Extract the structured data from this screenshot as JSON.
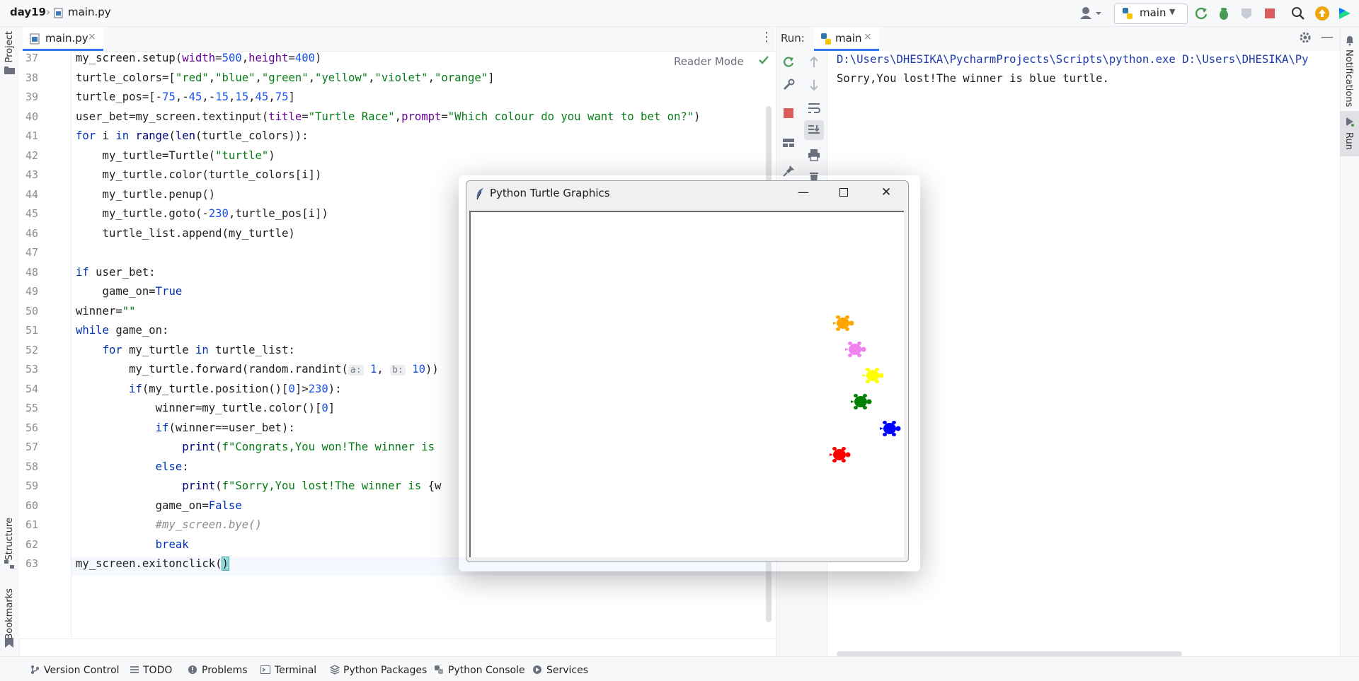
{
  "topbar": {
    "project": "day19",
    "separator": "›",
    "file": "main.py",
    "branch": "main"
  },
  "left_strip": {
    "project_label": "Project",
    "structure_label": "Structure",
    "bookmarks_label": "Bookmarks"
  },
  "right_strip": {
    "notifications_label": "Notifications",
    "run_label": "Run"
  },
  "editor": {
    "tab_label": "main.py",
    "tab_close": "×",
    "more_glyph": "⋮",
    "reader_mode": "Reader Mode",
    "line_numbers": [
      "37",
      "38",
      "39",
      "40",
      "41",
      "42",
      "43",
      "44",
      "45",
      "46",
      "47",
      "48",
      "49",
      "50",
      "51",
      "52",
      "53",
      "54",
      "55",
      "56",
      "57",
      "58",
      "59",
      "60",
      "61",
      "62",
      "63"
    ],
    "lines": [
      {
        "segs": [
          {
            "t": "my_screen.setup(",
            "c": ""
          },
          {
            "t": "width",
            "c": "pm"
          },
          {
            "t": "=",
            "c": ""
          },
          {
            "t": "500",
            "c": "nm"
          },
          {
            "t": ",",
            "c": ""
          },
          {
            "t": "height",
            "c": "pm"
          },
          {
            "t": "=",
            "c": ""
          },
          {
            "t": "400",
            "c": "nm"
          },
          {
            "t": ")",
            "c": ""
          }
        ]
      },
      {
        "segs": [
          {
            "t": "turtle_colors=[",
            "c": ""
          },
          {
            "t": "\"red\"",
            "c": "st"
          },
          {
            "t": ",",
            "c": ""
          },
          {
            "t": "\"blue\"",
            "c": "st"
          },
          {
            "t": ",",
            "c": ""
          },
          {
            "t": "\"green\"",
            "c": "st"
          },
          {
            "t": ",",
            "c": ""
          },
          {
            "t": "\"yellow\"",
            "c": "st"
          },
          {
            "t": ",",
            "c": ""
          },
          {
            "t": "\"violet\"",
            "c": "st"
          },
          {
            "t": ",",
            "c": ""
          },
          {
            "t": "\"orange\"",
            "c": "st"
          },
          {
            "t": "]",
            "c": ""
          }
        ]
      },
      {
        "segs": [
          {
            "t": "turtle_pos=[-",
            "c": ""
          },
          {
            "t": "75",
            "c": "nm"
          },
          {
            "t": ",-",
            "c": ""
          },
          {
            "t": "45",
            "c": "nm"
          },
          {
            "t": ",-",
            "c": ""
          },
          {
            "t": "15",
            "c": "nm"
          },
          {
            "t": ",",
            "c": ""
          },
          {
            "t": "15",
            "c": "nm"
          },
          {
            "t": ",",
            "c": ""
          },
          {
            "t": "45",
            "c": "nm"
          },
          {
            "t": ",",
            "c": ""
          },
          {
            "t": "75",
            "c": "nm"
          },
          {
            "t": "]",
            "c": ""
          }
        ]
      },
      {
        "segs": [
          {
            "t": "user_bet=my_screen.textinput(",
            "c": ""
          },
          {
            "t": "title",
            "c": "pm"
          },
          {
            "t": "=",
            "c": ""
          },
          {
            "t": "\"Turtle Race\"",
            "c": "st"
          },
          {
            "t": ",",
            "c": ""
          },
          {
            "t": "prompt",
            "c": "pm"
          },
          {
            "t": "=",
            "c": ""
          },
          {
            "t": "\"Which colour do you want to bet on?\"",
            "c": "st"
          },
          {
            "t": ")",
            "c": ""
          }
        ]
      },
      {
        "segs": [
          {
            "t": "for",
            "c": "kw"
          },
          {
            "t": " i ",
            "c": ""
          },
          {
            "t": "in",
            "c": "kw"
          },
          {
            "t": " ",
            "c": ""
          },
          {
            "t": "range",
            "c": "bi"
          },
          {
            "t": "(",
            "c": ""
          },
          {
            "t": "len",
            "c": "bi"
          },
          {
            "t": "(turtle_colors)):",
            "c": ""
          }
        ]
      },
      {
        "segs": [
          {
            "t": "    my_turtle=Turtle(",
            "c": ""
          },
          {
            "t": "\"turtle\"",
            "c": "st"
          },
          {
            "t": ")",
            "c": ""
          }
        ]
      },
      {
        "segs": [
          {
            "t": "    my_turtle.color(turtle_colors[i])",
            "c": ""
          }
        ]
      },
      {
        "segs": [
          {
            "t": "    my_turtle.penup()",
            "c": ""
          }
        ]
      },
      {
        "segs": [
          {
            "t": "    my_turtle.goto(-",
            "c": ""
          },
          {
            "t": "230",
            "c": "nm"
          },
          {
            "t": ",turtle_pos[i])",
            "c": ""
          }
        ]
      },
      {
        "segs": [
          {
            "t": "    turtle_list.append(my_turtle)",
            "c": ""
          }
        ]
      },
      {
        "segs": []
      },
      {
        "segs": [
          {
            "t": "if",
            "c": "kw"
          },
          {
            "t": " user_bet:",
            "c": ""
          }
        ]
      },
      {
        "segs": [
          {
            "t": "    game_on=",
            "c": ""
          },
          {
            "t": "True",
            "c": "kw"
          }
        ]
      },
      {
        "segs": [
          {
            "t": "winner=",
            "c": ""
          },
          {
            "t": "\"\"",
            "c": "st"
          }
        ]
      },
      {
        "segs": [
          {
            "t": "while",
            "c": "kw"
          },
          {
            "t": " game_on:",
            "c": ""
          }
        ]
      },
      {
        "segs": [
          {
            "t": "    ",
            "c": ""
          },
          {
            "t": "for",
            "c": "kw"
          },
          {
            "t": " my_turtle ",
            "c": ""
          },
          {
            "t": "in",
            "c": "kw"
          },
          {
            "t": " turtle_list:",
            "c": ""
          }
        ]
      },
      {
        "segs": [
          {
            "t": "        my_turtle.forward(random.randint(",
            "c": ""
          },
          {
            "t": "a:",
            "c": "hint"
          },
          {
            "t": " ",
            "c": ""
          },
          {
            "t": "1",
            "c": "nm"
          },
          {
            "t": ", ",
            "c": ""
          },
          {
            "t": "b:",
            "c": "hint"
          },
          {
            "t": " ",
            "c": ""
          },
          {
            "t": "10",
            "c": "nm"
          },
          {
            "t": "))",
            "c": ""
          }
        ]
      },
      {
        "segs": [
          {
            "t": "        ",
            "c": ""
          },
          {
            "t": "if",
            "c": "kw"
          },
          {
            "t": "(my_turtle.position()[",
            "c": ""
          },
          {
            "t": "0",
            "c": "nm"
          },
          {
            "t": "]>",
            "c": ""
          },
          {
            "t": "230",
            "c": "nm"
          },
          {
            "t": "):",
            "c": ""
          }
        ]
      },
      {
        "segs": [
          {
            "t": "            winner=my_turtle.color()[",
            "c": ""
          },
          {
            "t": "0",
            "c": "nm"
          },
          {
            "t": "]",
            "c": ""
          }
        ]
      },
      {
        "segs": [
          {
            "t": "            ",
            "c": ""
          },
          {
            "t": "if",
            "c": "kw"
          },
          {
            "t": "(winner==user_bet):",
            "c": ""
          }
        ]
      },
      {
        "segs": [
          {
            "t": "                ",
            "c": ""
          },
          {
            "t": "print",
            "c": "bi"
          },
          {
            "t": "(",
            "c": ""
          },
          {
            "t": "f\"Congrats,You won!The winner is",
            "c": "st"
          }
        ]
      },
      {
        "segs": [
          {
            "t": "            ",
            "c": ""
          },
          {
            "t": "else",
            "c": "kw"
          },
          {
            "t": ":",
            "c": ""
          }
        ]
      },
      {
        "segs": [
          {
            "t": "                ",
            "c": ""
          },
          {
            "t": "print",
            "c": "bi"
          },
          {
            "t": "(",
            "c": ""
          },
          {
            "t": "f\"Sorry,You lost!The winner is ",
            "c": "st"
          },
          {
            "t": "{w",
            "c": ""
          }
        ]
      },
      {
        "segs": [
          {
            "t": "            game_on=",
            "c": ""
          },
          {
            "t": "False",
            "c": "kw"
          }
        ]
      },
      {
        "segs": [
          {
            "t": "            ",
            "c": ""
          },
          {
            "t": "#my_screen.bye()",
            "c": "cm"
          }
        ]
      },
      {
        "segs": [
          {
            "t": "            ",
            "c": ""
          },
          {
            "t": "break",
            "c": "kw"
          }
        ]
      },
      {
        "segs": [
          {
            "t": "my_screen.exitonclick(",
            "c": ""
          },
          {
            "t": ")",
            "c": "bracket"
          }
        ]
      }
    ]
  },
  "run_panel": {
    "label": "Run:",
    "tab_label": "main",
    "tab_close": "×",
    "minimize_glyph": "—",
    "output": [
      "D:\\Users\\DHESIKA\\PycharmProjects\\Scripts\\python.exe D:\\Users\\DHESIKA\\Py",
      "Sorry,You lost!The winner is blue turtle."
    ]
  },
  "bottom_bar": {
    "items": [
      "Version Control",
      "TODO",
      "Problems",
      "Terminal",
      "Python Packages",
      "Python Console",
      "Services"
    ]
  },
  "turtle_window": {
    "title": "Python Turtle Graphics",
    "min_glyph": "—",
    "close_glyph": "✕",
    "turtles": [
      {
        "color": "orange",
        "hex": "#ffa500"
      },
      {
        "color": "violet",
        "hex": "#ee82ee"
      },
      {
        "color": "yellow",
        "hex": "#ffff00"
      },
      {
        "color": "green",
        "hex": "#008000"
      },
      {
        "color": "blue",
        "hex": "#0000ff"
      },
      {
        "color": "red",
        "hex": "#ff0000"
      }
    ]
  },
  "colors": {
    "accent": "#3574f0",
    "keyword": "#0033b3",
    "string": "#067d17",
    "number": "#1750eb",
    "stop_red": "#db5c5c",
    "run_green": "#499c54"
  }
}
